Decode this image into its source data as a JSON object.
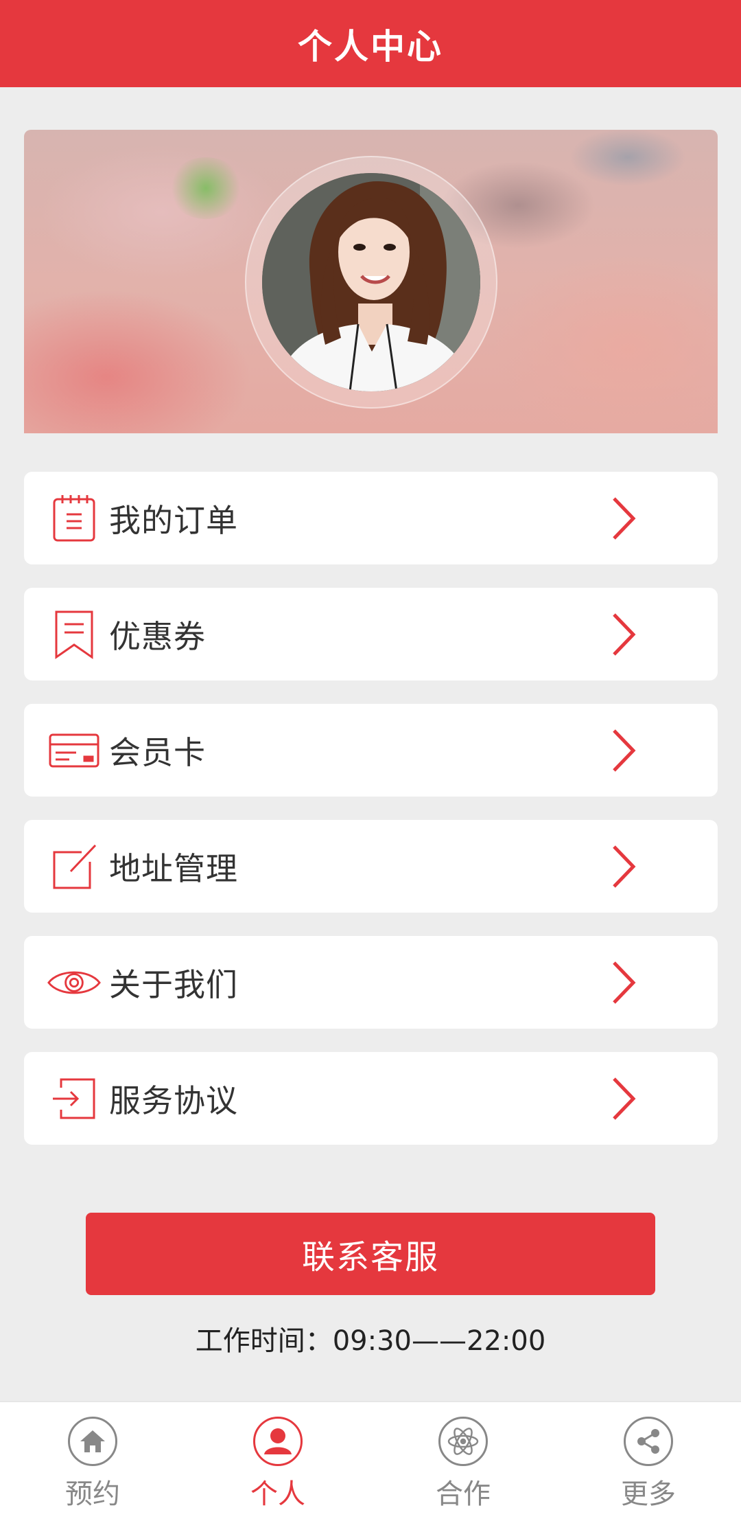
{
  "header": {
    "title": "个人中心"
  },
  "menu": {
    "items": [
      {
        "label": "我的订单",
        "icon": "order-clipboard-icon"
      },
      {
        "label": "优惠券",
        "icon": "coupon-bookmark-icon"
      },
      {
        "label": "会员卡",
        "icon": "member-card-icon"
      },
      {
        "label": "地址管理",
        "icon": "edit-square-icon"
      },
      {
        "label": "关于我们",
        "icon": "eye-icon"
      },
      {
        "label": "服务协议",
        "icon": "login-arrow-icon"
      }
    ]
  },
  "contact": {
    "button_label": "联系客服",
    "work_time": "工作时间：09:30——22:00"
  },
  "tabbar": {
    "items": [
      {
        "label": "预约",
        "icon": "home-icon",
        "active": false
      },
      {
        "label": "个人",
        "icon": "user-icon",
        "active": true
      },
      {
        "label": "合作",
        "icon": "atom-icon",
        "active": false
      },
      {
        "label": "更多",
        "icon": "share-icon",
        "active": false
      }
    ]
  },
  "colors": {
    "accent": "#e5383e",
    "background": "#ededed",
    "inactive": "#888888"
  }
}
